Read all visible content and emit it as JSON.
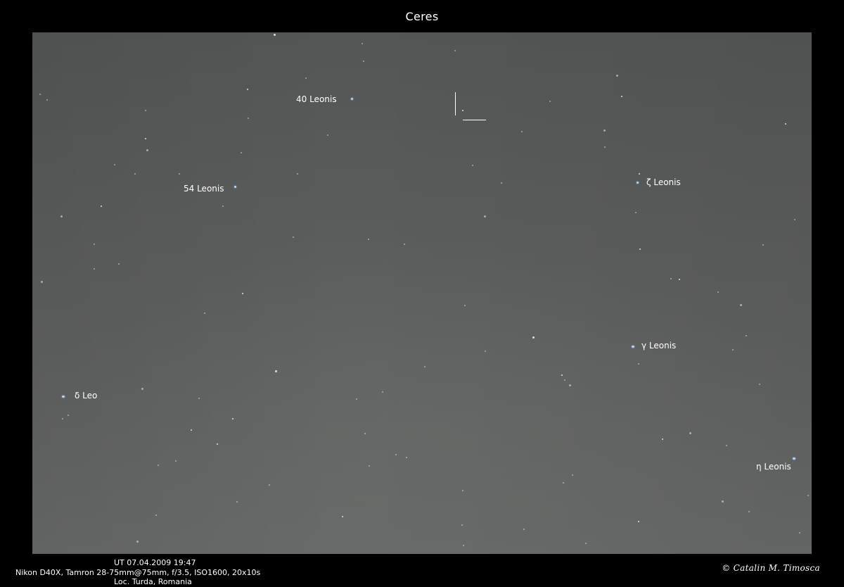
{
  "title": "Ceres",
  "labels": {
    "leonis40": "40 Leonis",
    "leonis54": "54 Leonis",
    "zeta": "ζ Leonis",
    "gamma": "γ Leonis",
    "delta": "δ Leo",
    "eta": "η Leonis"
  },
  "caption": {
    "time": "UT 07.04.2009 19:47",
    "equipment": "Nikon D40X, Tamron 28-75mm@75mm, f/3.5, ISO1600, 20x10s",
    "location": "Loc. Turda, Romania"
  },
  "credit": "© Catalin M. Timosca",
  "colors": {
    "background": "#000000",
    "sky": "#5a5c5b",
    "star": "#e8eef8",
    "bright_star": "#bcd4ff"
  }
}
